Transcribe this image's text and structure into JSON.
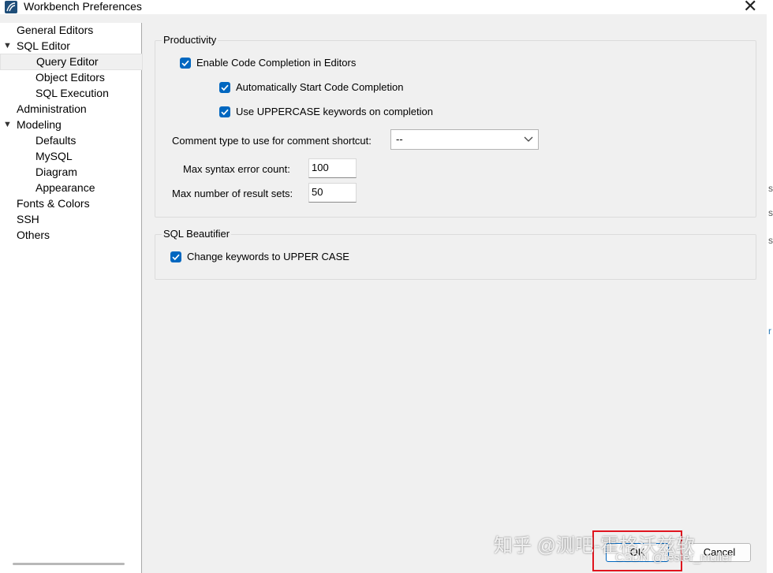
{
  "window": {
    "title": "Workbench Preferences",
    "close_glyph": "✕"
  },
  "sidebar": {
    "items": [
      {
        "label": "General Editors",
        "level": 0,
        "expanded": null
      },
      {
        "label": "SQL Editor",
        "level": 0,
        "expanded": true
      },
      {
        "label": "Query Editor",
        "level": 1,
        "selected": true
      },
      {
        "label": "Object Editors",
        "level": 1
      },
      {
        "label": "SQL Execution",
        "level": 1
      },
      {
        "label": "Administration",
        "level": 0
      },
      {
        "label": "Modeling",
        "level": 0,
        "expanded": true
      },
      {
        "label": "Defaults",
        "level": 1
      },
      {
        "label": "MySQL",
        "level": 1
      },
      {
        "label": "Diagram",
        "level": 1
      },
      {
        "label": "Appearance",
        "level": 1
      },
      {
        "label": "Fonts & Colors",
        "level": 0
      },
      {
        "label": "SSH",
        "level": 0
      },
      {
        "label": "Others",
        "level": 0
      }
    ],
    "expand_glyph": "▼"
  },
  "productivity": {
    "title": "Productivity",
    "enable_code_completion": {
      "label": "Enable Code Completion in Editors",
      "checked": true
    },
    "auto_start_completion": {
      "label": "Automatically Start Code Completion",
      "checked": true
    },
    "uppercase_keywords": {
      "label": "Use UPPERCASE keywords on completion",
      "checked": true
    },
    "comment_type": {
      "label": "Comment type to use for comment shortcut:",
      "value": "--"
    },
    "max_syntax_errors": {
      "label": "Max syntax error count:",
      "value": "100"
    },
    "max_result_sets": {
      "label": "Max number of result sets:",
      "value": "50"
    }
  },
  "beautifier": {
    "title": "SQL Beautifier",
    "change_keywords_upper": {
      "label": "Change keywords to UPPER CASE",
      "checked": true
    }
  },
  "buttons": {
    "ok": "OK",
    "cancel": "Cancel"
  },
  "right_edge_chars": [
    "s",
    "s",
    "s",
    "r"
  ],
  "watermarks": {
    "zhihu": "知乎 @测吧-霍格沃兹软",
    "csdn": "CSDN @fester_muller"
  },
  "colors": {
    "checkbox": "#0067c0",
    "highlight_box": "#e0141e"
  }
}
